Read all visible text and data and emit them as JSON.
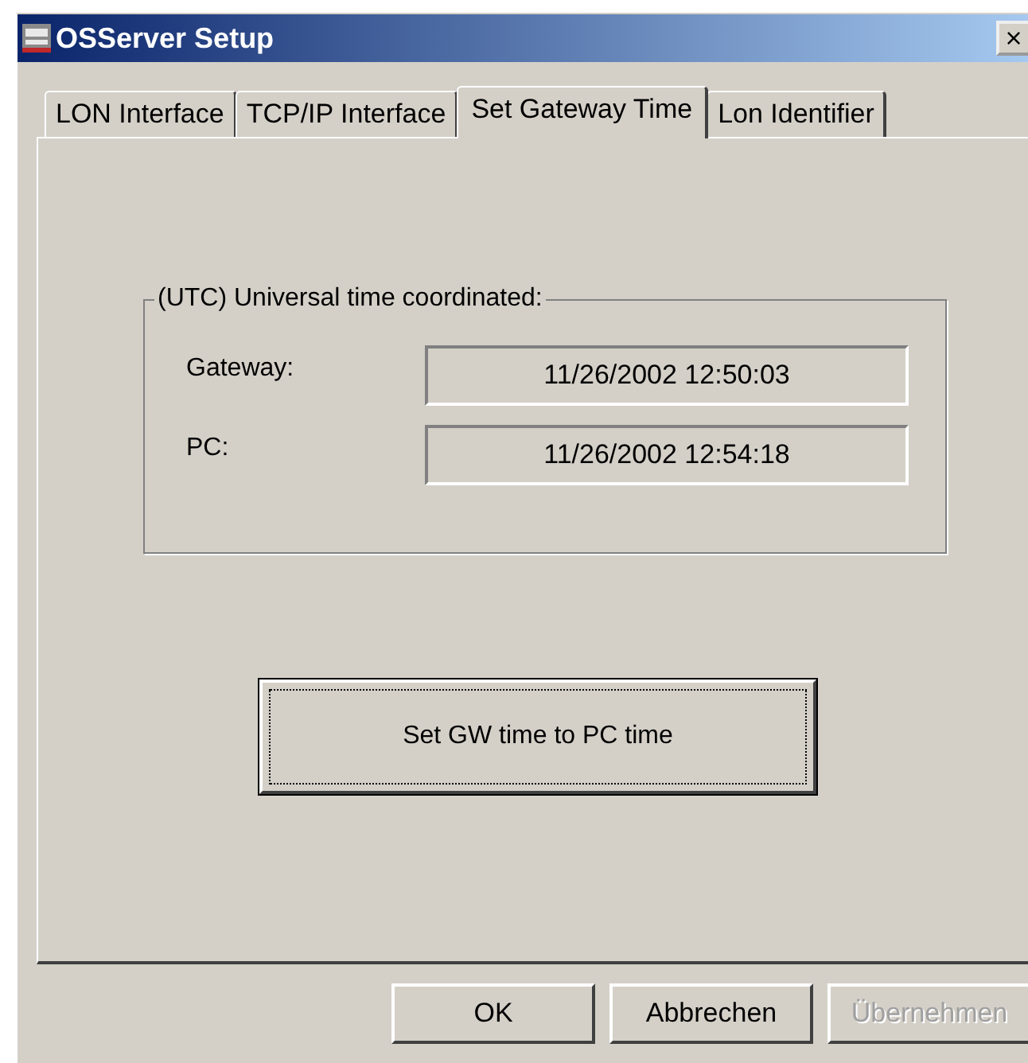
{
  "window": {
    "title": "OSServer Setup",
    "close": "×"
  },
  "tabs": [
    {
      "label": "LON Interface",
      "selected": false
    },
    {
      "label": "TCP/IP Interface",
      "selected": false
    },
    {
      "label": "Set Gateway Time",
      "selected": true
    },
    {
      "label": "Lon Identifier",
      "selected": false
    }
  ],
  "group": {
    "title": "(UTC) Universal time coordinated:",
    "fields": [
      {
        "label": "Gateway:",
        "value": "11/26/2002 12:50:03"
      },
      {
        "label": "PC:",
        "value": "11/26/2002 12:54:18"
      }
    ]
  },
  "action_button": {
    "label": "Set GW time to PC time"
  },
  "buttons": [
    {
      "label": "OK",
      "disabled": false
    },
    {
      "label": "Abbrechen",
      "disabled": false
    },
    {
      "label": "Übernehmen",
      "disabled": true
    }
  ]
}
